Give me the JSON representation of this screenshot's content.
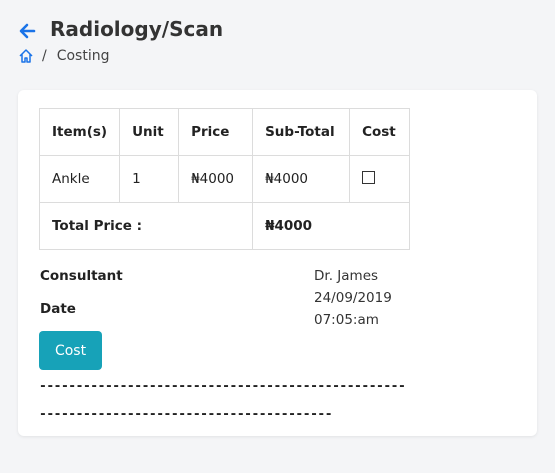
{
  "header": {
    "title": "Radiology/Scan"
  },
  "breadcrumb": {
    "separator": "/",
    "current": "Costing"
  },
  "table": {
    "headers": [
      "Item(s)",
      "Unit",
      "Price",
      "Sub-Total",
      "Cost"
    ],
    "rows": [
      {
        "item": "Ankle",
        "unit": "1",
        "price": "₦4000",
        "subtotal": "₦4000",
        "cost_checked": false
      }
    ],
    "total_label": "Total Price :",
    "total_value": "₦4000"
  },
  "info": {
    "consultant_label": "Consultant",
    "consultant_value": "Dr. James",
    "date_label": "Date",
    "date_value": "24/09/2019",
    "time_value": "07:05:am"
  },
  "actions": {
    "cost_label": "Cost"
  },
  "separator_text": "------------------------------------------------------------------------------------------",
  "colors": {
    "accent": "#17a2b8",
    "link": "#1a73e8"
  }
}
